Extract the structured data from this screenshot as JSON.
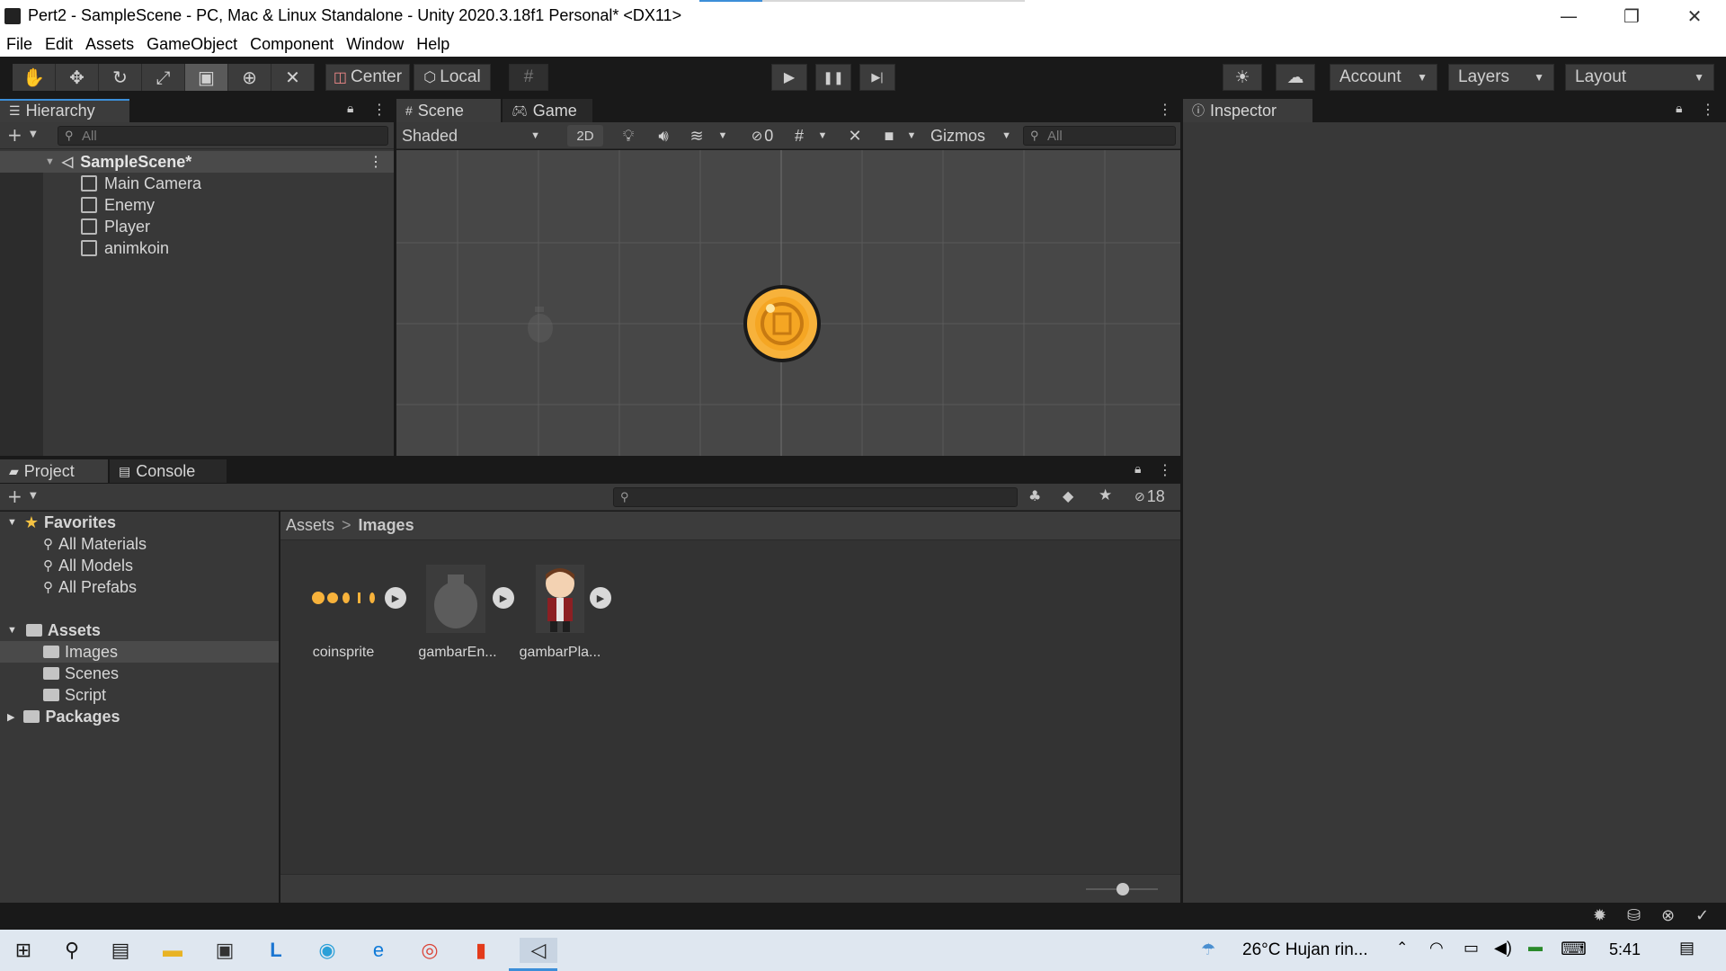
{
  "window": {
    "title": "Pert2 - SampleScene - PC, Mac & Linux Standalone - Unity 2020.3.18f1 Personal* <DX11>",
    "minimize": "—",
    "restore": "❐",
    "close": "✕"
  },
  "menu": [
    "File",
    "Edit",
    "Assets",
    "GameObject",
    "Component",
    "Window",
    "Help"
  ],
  "toolbar": {
    "tools": [
      {
        "name": "hand-tool",
        "glyph": "✋"
      },
      {
        "name": "move-tool",
        "glyph": "✥"
      },
      {
        "name": "rotate-tool",
        "glyph": "↻"
      },
      {
        "name": "scale-tool",
        "glyph": "⤢"
      },
      {
        "name": "rect-tool",
        "glyph": "▣"
      },
      {
        "name": "transform-tool",
        "glyph": "⊕"
      },
      {
        "name": "custom-tool",
        "glyph": "✕"
      }
    ],
    "pivot_mode": "Center",
    "pivot_rotation": "Local",
    "grid_snap": "#",
    "play": "▶",
    "pause": "❚❚",
    "step": "▶|",
    "collab": "☀",
    "cloud": "☁",
    "account": "Account",
    "layers": "Layers",
    "layout": "Layout"
  },
  "hierarchy": {
    "tab": "Hierarchy",
    "search_placeholder": "All",
    "scene": "SampleScene*",
    "items": [
      "Main Camera",
      "Enemy",
      "Player",
      "animkoin"
    ]
  },
  "scene_tabs": {
    "scene": "Scene",
    "game": "Game"
  },
  "scene_toolbar": {
    "shading": "Shaded",
    "mode_2d": "2D",
    "hidden_count": "0",
    "gizmos": "Gizmos",
    "search_placeholder": "All"
  },
  "inspector": {
    "tab": "Inspector"
  },
  "project": {
    "tab_project": "Project",
    "tab_console": "Console",
    "hidden_count": "18",
    "favorites": {
      "label": "Favorites",
      "items": [
        "All Materials",
        "All Models",
        "All Prefabs"
      ]
    },
    "assets": {
      "label": "Assets",
      "items": [
        "Images",
        "Scenes",
        "Script"
      ]
    },
    "packages": "Packages",
    "breadcrumb": {
      "root": "Assets",
      "separator": ">",
      "current": "Images"
    },
    "files": [
      "coinsprite",
      "gambarEn...",
      "gambarPla..."
    ]
  },
  "taskbar": {
    "weather": "26°C  Hujan rin...",
    "time": "5:41"
  },
  "colors": {
    "accent": "#3c8ed8",
    "coin": "#f7b23b",
    "coin_dark": "#c77a12"
  }
}
